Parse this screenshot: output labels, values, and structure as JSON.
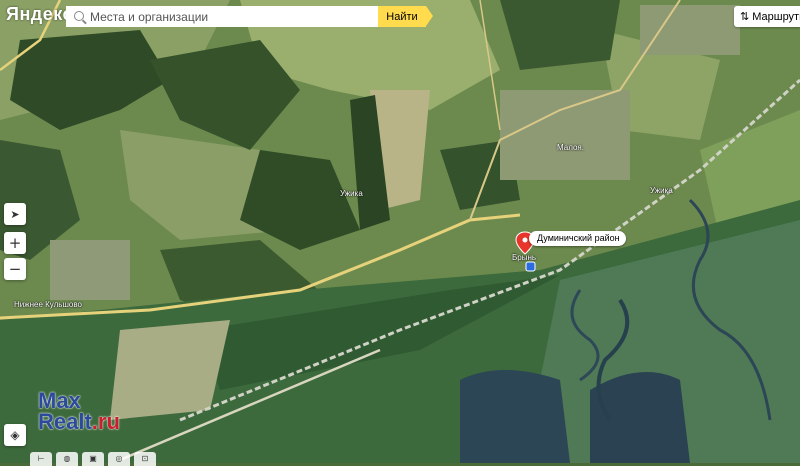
{
  "header": {
    "logo": "Яндекс",
    "search": {
      "placeholder": "Места и организации",
      "value": ""
    },
    "find_label": "Найти",
    "routes_label": "Маршруты"
  },
  "controls": {
    "locate_icon": "locate-arrow-icon",
    "zoom_in": "+",
    "zoom_out": "−",
    "layers_icon": "layers-icon"
  },
  "marker": {
    "label": "Думиничский район",
    "color": "#e8352b"
  },
  "map_labels": {
    "village_left": "Нижнее Кульшово",
    "village_top": "Малоя.",
    "river_1": "Ужика",
    "river_2": "Ужика",
    "station": "Брынь"
  },
  "watermark": {
    "line1": "Max",
    "line2_a": "Realt",
    "line2_b": ".ru"
  },
  "colors": {
    "search_button": "#ffdb4d",
    "road": "#e6d27a"
  }
}
